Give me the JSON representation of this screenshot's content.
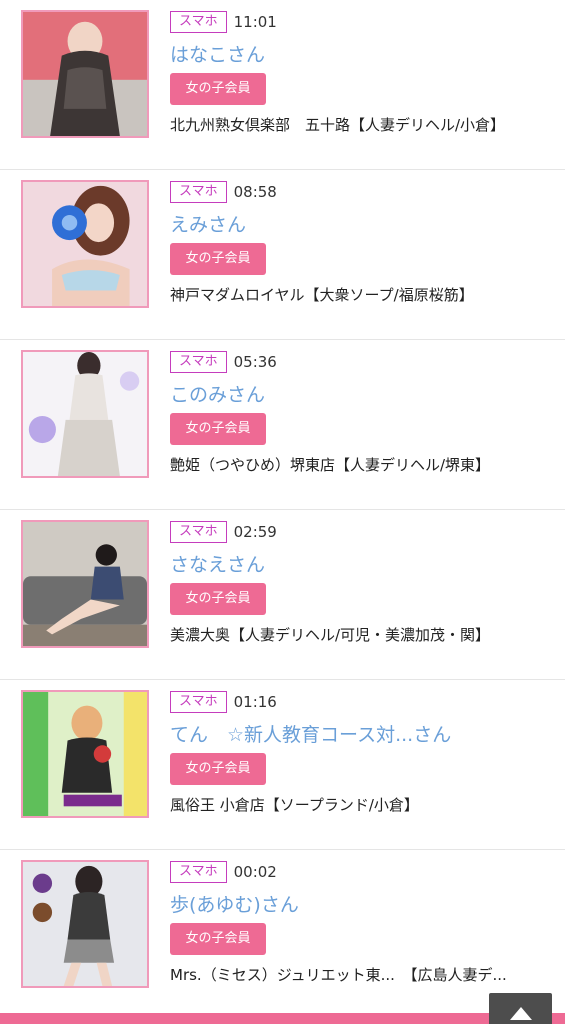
{
  "entries": [
    {
      "badge": "スマホ",
      "time": "11:01",
      "name": "はなこさん",
      "member_label": "女の子会員",
      "shop": "北九州熟女倶楽部　五十路【人妻デリヘル/小倉】",
      "thumb_icon": "profile-photo"
    },
    {
      "badge": "スマホ",
      "time": "08:58",
      "name": "えみさん",
      "member_label": "女の子会員",
      "shop": "神戸マダムロイヤル【大衆ソープ/福原桜筋】",
      "thumb_icon": "profile-photo"
    },
    {
      "badge": "スマホ",
      "time": "05:36",
      "name": "このみさん",
      "member_label": "女の子会員",
      "shop": "艶姫（つやひめ）堺東店【人妻デリヘル/堺東】",
      "thumb_icon": "profile-photo"
    },
    {
      "badge": "スマホ",
      "time": "02:59",
      "name": "さなえさん",
      "member_label": "女の子会員",
      "shop": "美濃大奥【人妻デリヘル/可児・美濃加茂・関】",
      "thumb_icon": "profile-photo"
    },
    {
      "badge": "スマホ",
      "time": "01:16",
      "name": "てん　☆新人教育コース対...さん",
      "member_label": "女の子会員",
      "shop": "風俗王 小倉店【ソープランド/小倉】",
      "thumb_icon": "profile-photo"
    },
    {
      "badge": "スマホ",
      "time": "00:02",
      "name": "歩(あゆむ)さん",
      "member_label": "女の子会員",
      "shop": "Mrs.（ミセス）ジュリエット東...　【広島人妻デ...",
      "thumb_icon": "profile-photo"
    }
  ],
  "scroll_top_button": {
    "icon": "arrow-up-icon"
  },
  "colors": {
    "accent_pink": "#ee6a94",
    "badge_purple": "#c53dbd",
    "name_blue": "#6a9fd8",
    "thumb_border": "#f09aba"
  }
}
